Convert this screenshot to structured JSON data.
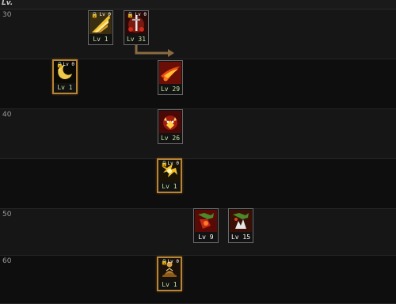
{
  "header": {
    "label": "Lv."
  },
  "rows": [
    {
      "label": "30"
    },
    {
      "label": ""
    },
    {
      "label": "40"
    },
    {
      "label": ""
    },
    {
      "label": "50"
    },
    {
      "label": "60"
    }
  ],
  "skills": [
    {
      "level_text": "Lv 1",
      "lock": "🔒",
      "tag": "Lv 0",
      "icon": "golden-slash-skill-icon"
    },
    {
      "level_text": "Lv 31",
      "lock": "🔒",
      "tag": "Lv 0",
      "icon": "sword-demon-skill-icon"
    },
    {
      "level_text": "Lv 1",
      "lock": "🔒",
      "tag": "Lv 0",
      "icon": "crescent-moon-skill-icon"
    },
    {
      "level_text": "Lv 29",
      "lock": "",
      "tag": "",
      "icon": "flame-slash-skill-icon"
    },
    {
      "level_text": "Lv 26",
      "lock": "",
      "tag": "",
      "icon": "demon-rage-skill-icon"
    },
    {
      "level_text": "Lv 1",
      "lock": "🔒",
      "tag": "Lv 0",
      "icon": "thunder-burst-skill-icon"
    },
    {
      "level_text": "Lv 9",
      "lock": "",
      "tag": "",
      "icon": "dragon-fist-skill-icon"
    },
    {
      "level_text": "Lv 15",
      "lock": "",
      "tag": "",
      "icon": "dragon-claw-skill-icon"
    },
    {
      "level_text": "Lv 1",
      "lock": "🔒",
      "tag": "Lv 0",
      "icon": "meditation-skill-icon"
    }
  ],
  "colors": {
    "level_text_learned": "#c8e6a0",
    "level_text_default": "#ffffff",
    "frame_gold": "#b88436",
    "connector": "#8a6a42"
  }
}
